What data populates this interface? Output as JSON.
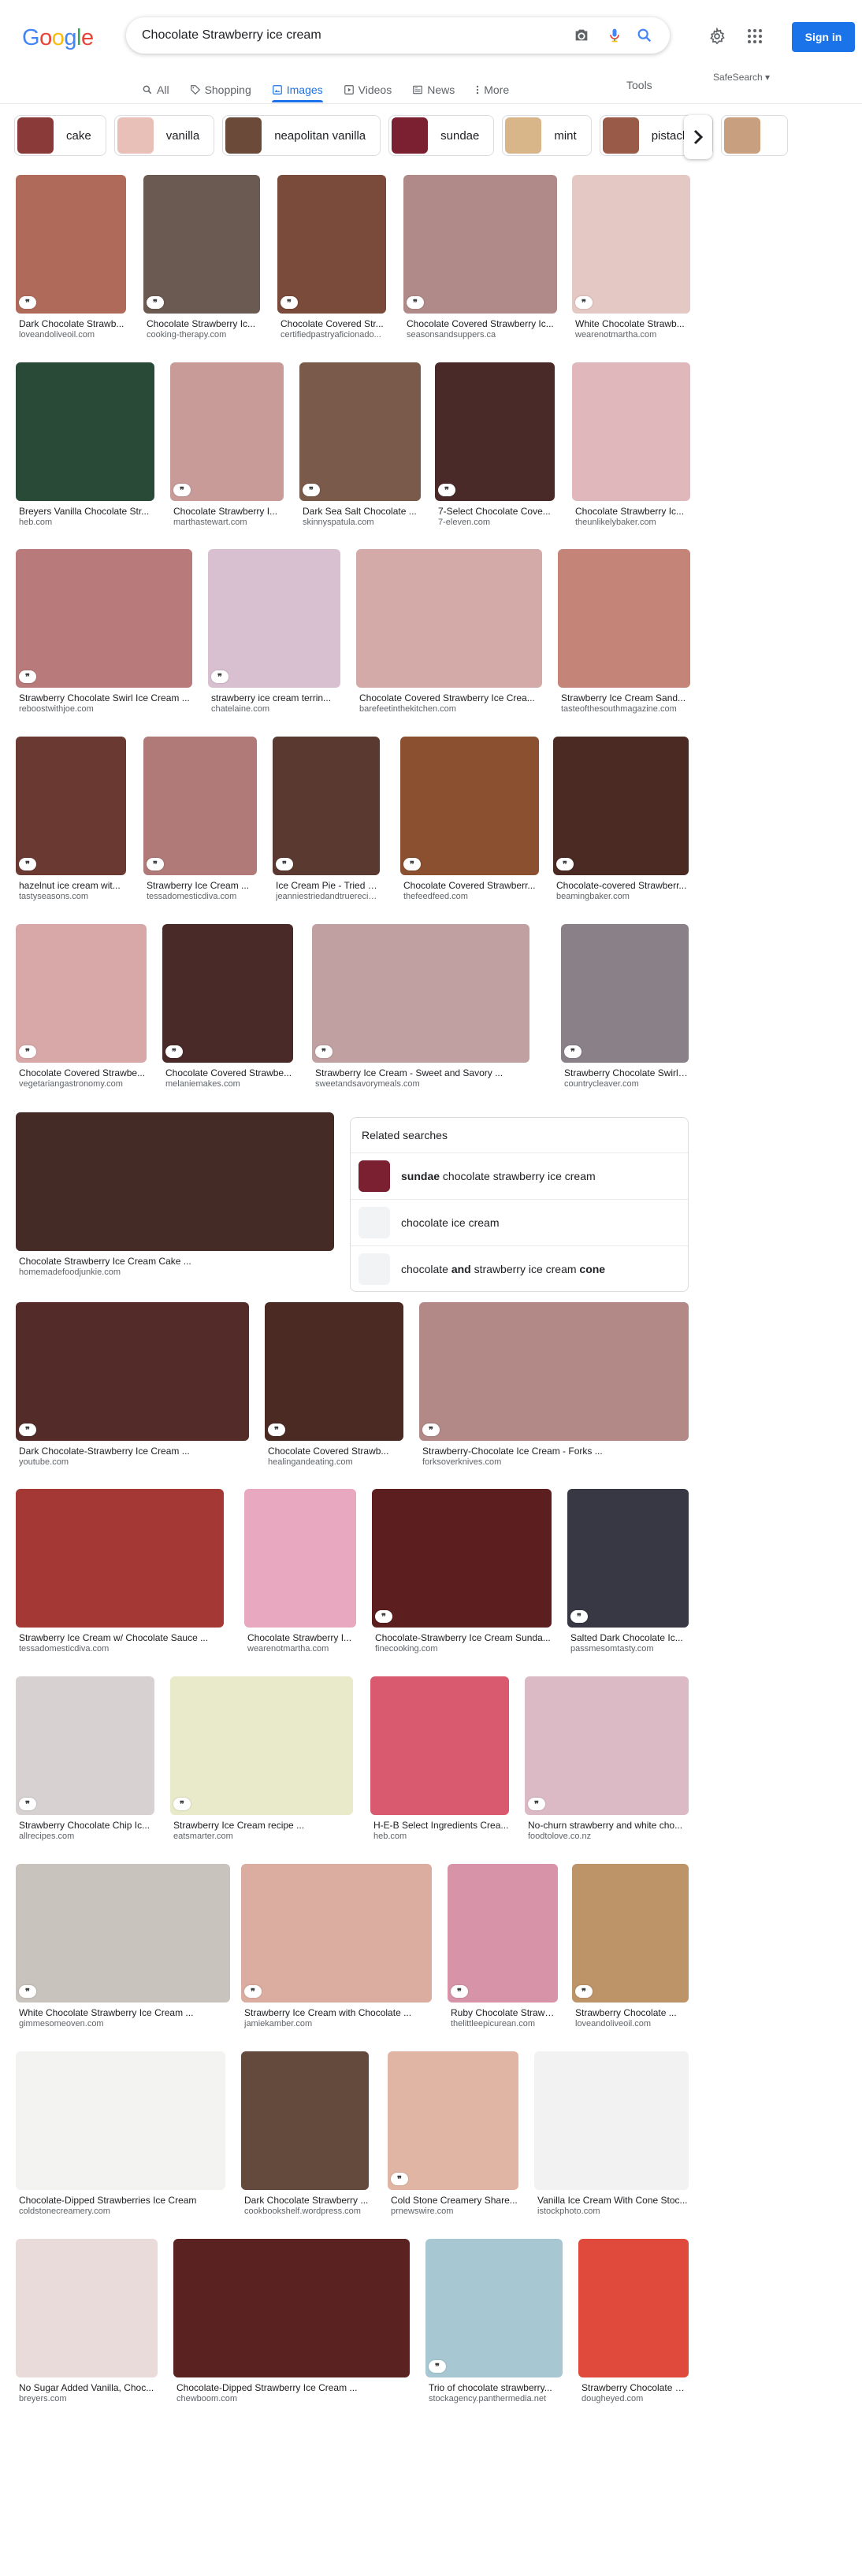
{
  "header": {
    "logo": "Google",
    "search_value": "Chocolate Strawberry ice cream",
    "signin_label": "Sign in",
    "tools_label": "Tools",
    "safesearch_label": "SafeSearch ▾"
  },
  "tabs": [
    {
      "label": "All",
      "icon": "search-icon"
    },
    {
      "label": "Shopping",
      "icon": "tag-icon"
    },
    {
      "label": "Images",
      "icon": "image-icon",
      "active": true
    },
    {
      "label": "Videos",
      "icon": "play-icon"
    },
    {
      "label": "News",
      "icon": "news-icon"
    },
    {
      "label": "More",
      "icon": "more-vert-icon"
    }
  ],
  "chips": [
    {
      "label": "cake",
      "color": "#8b3a3a"
    },
    {
      "label": "vanilla",
      "color": "#e8c0b8"
    },
    {
      "label": "neapolitan vanilla",
      "color": "#6b4a3a"
    },
    {
      "label": "sundae",
      "color": "#7a2030"
    },
    {
      "label": "mint",
      "color": "#d9b58a"
    },
    {
      "label": "pistachio",
      "color": "#9a5a48"
    },
    {
      "label": "",
      "color": "#c8a080"
    }
  ],
  "images": [
    {
      "title": "Dark Chocolate Strawb...",
      "source": "loveandoliveoil.com",
      "color": "#b06a5a"
    },
    {
      "title": "Chocolate Strawberry Ic...",
      "source": "cooking-therapy.com",
      "color": "#6a5a52"
    },
    {
      "title": "Chocolate Covered Str...",
      "source": "certifiedpastryaficionado...",
      "color": "#7a4a3a"
    },
    {
      "title": "Chocolate Covered Strawberry Ic...",
      "source": "seasonsandsuppers.ca",
      "color": "#b08a88"
    },
    {
      "title": "White Chocolate Strawb...",
      "source": "wearenotmartha.com",
      "color": "#e4c8c4"
    },
    {
      "title": "Breyers Vanilla Chocolate Str...",
      "source": "heb.com",
      "color": "#2a4a38"
    },
    {
      "title": "Chocolate Strawberry I...",
      "source": "marthastewart.com",
      "color": "#c89a98"
    },
    {
      "title": "Dark Sea Salt Chocolate ...",
      "source": "skinnyspatula.com",
      "color": "#7a5a4a"
    },
    {
      "title": "7-Select Chocolate Cove...",
      "source": "7-eleven.com",
      "color": "#4a2a28"
    },
    {
      "title": "Chocolate Strawberry Ic...",
      "source": "theunlikelybaker.com",
      "color": "#e0b8bc"
    },
    {
      "title": "Strawberry Chocolate Swirl Ice Cream ...",
      "source": "reboostwithjoe.com",
      "color": "#b87a7a"
    },
    {
      "title": "strawberry ice cream terrin...",
      "source": "chatelaine.com",
      "color": "#d8c0d0"
    },
    {
      "title": "Chocolate Covered Strawberry Ice Crea...",
      "source": "barefeetinthekitchen.com",
      "color": "#d4aaa8"
    },
    {
      "title": "Strawberry Ice Cream Sand...",
      "source": "tasteofthesouthmagazine.com",
      "color": "#c48478"
    },
    {
      "title": "hazelnut ice cream wit...",
      "source": "tastyseasons.com",
      "color": "#6a3a32"
    },
    {
      "title": "Strawberry Ice Cream ...",
      "source": "tessadomesticdiva.com",
      "color": "#b07a78"
    },
    {
      "title": "Ice Cream Pie - Tried a...",
      "source": "jeanniestriedandtruerecip...",
      "color": "#5a3a30"
    },
    {
      "title": "Chocolate Covered Strawberr...",
      "source": "thefeedfeed.com",
      "color": "#8a5030"
    },
    {
      "title": "Chocolate-covered Strawberr...",
      "source": "beamingbaker.com",
      "color": "#4a2a22"
    },
    {
      "title": "Chocolate Covered Strawbe...",
      "source": "vegetariangastronomy.com",
      "color": "#d8a8a8"
    },
    {
      "title": "Chocolate Covered Strawbe...",
      "source": "melaniemakes.com",
      "color": "#4a2a28"
    },
    {
      "title": "Strawberry Ice Cream - Sweet and Savory ...",
      "source": "sweetandsavorymeals.com",
      "color": "#c0a0a0"
    },
    {
      "title": "Strawberry Chocolate Swirl ...",
      "source": "countrycleaver.com",
      "color": "#8a8088"
    },
    {
      "title": "Chocolate Strawberry Ice Cream Cake ...",
      "source": "homemadefoodjunkie.com",
      "color": "#452b25"
    },
    {
      "title": "Dark Chocolate-Strawberry Ice Cream ...",
      "source": "youtube.com",
      "color": "#532c29"
    },
    {
      "title": "Chocolate Covered Strawb...",
      "source": "healingandeating.com",
      "color": "#4b2a23"
    },
    {
      "title": "Strawberry-Chocolate Ice Cream - Forks ...",
      "source": "forksoverknives.com",
      "color": "#b28987"
    },
    {
      "title": "Strawberry Ice Cream w/ Chocolate Sauce ...",
      "source": "tessadomesticdiva.com",
      "color": "#a33835"
    },
    {
      "title": "Chocolate Strawberry I...",
      "source": "wearenotmartha.com",
      "color": "#e8a8c0"
    },
    {
      "title": "Chocolate-Strawberry Ice Cream Sunda...",
      "source": "finecooking.com",
      "color": "#5c1e1e"
    },
    {
      "title": "Salted Dark Chocolate Ic...",
      "source": "passmesomtasty.com",
      "color": "#383845"
    },
    {
      "title": "Strawberry Chocolate Chip Ic...",
      "source": "allrecipes.com",
      "color": "#d7d2d1"
    },
    {
      "title": "Strawberry Ice Cream recipe ...",
      "source": "eatsmarter.com",
      "color": "#e9eaca"
    },
    {
      "title": "H-E-B Select Ingredients Crea...",
      "source": "heb.com",
      "color": "#d95a6e"
    },
    {
      "title": "No-churn strawberry and white cho...",
      "source": "foodtolove.co.nz",
      "color": "#dbbac6"
    },
    {
      "title": "White Chocolate Strawberry Ice Cream ...",
      "source": "gimmesomeoven.com",
      "color": "#c8c3bd"
    },
    {
      "title": "Strawberry Ice Cream with Chocolate ...",
      "source": "jamiekamber.com",
      "color": "#dbada0"
    },
    {
      "title": "Ruby Chocolate Strawb...",
      "source": "thelittleepicurean.com",
      "color": "#d794a8"
    },
    {
      "title": "Strawberry Chocolate ...",
      "source": "loveandoliveoil.com",
      "color": "#bd9467"
    },
    {
      "title": "Chocolate-Dipped Strawberries Ice Cream",
      "source": "coldstonecreamery.com",
      "color": "#f3f3f1"
    },
    {
      "title": "Dark Chocolate Strawberry ...",
      "source": "cookbookshelf.wordpress.com",
      "color": "#644a3c"
    },
    {
      "title": "Cold Stone Creamery Share...",
      "source": "prnewswire.com",
      "color": "#e1b5a4"
    },
    {
      "title": "Vanilla Ice Cream With Cone Stoc...",
      "source": "istockphoto.com",
      "color": "#f2f2f2"
    },
    {
      "title": "No Sugar Added Vanilla, Choc...",
      "source": "breyers.com",
      "color": "#e9dbd9"
    },
    {
      "title": "Chocolate-Dipped Strawberry Ice Cream ...",
      "source": "chewboom.com",
      "color": "#5a2321"
    },
    {
      "title": "Trio of chocolate strawberry...",
      "source": "stockagency.panthermedia.net",
      "color": "#a7c8d3"
    },
    {
      "title": "Strawberry Chocolate C...",
      "source": "dougheyed.com",
      "color": "#e04a3d"
    }
  ],
  "related": {
    "title": "Related searches",
    "items": [
      {
        "bold": "sundae",
        "rest": " chocolate strawberry ice cream",
        "pre": "",
        "color": "#7a2030"
      },
      {
        "bold": "",
        "rest": "chocolate ice cream",
        "pre": "",
        "color": "#f1f3f4"
      },
      {
        "pre": "chocolate ",
        "bold": "and",
        "rest": " strawberry ice cream ",
        "tail": "cone",
        "color": "#f1f3f4"
      }
    ]
  }
}
